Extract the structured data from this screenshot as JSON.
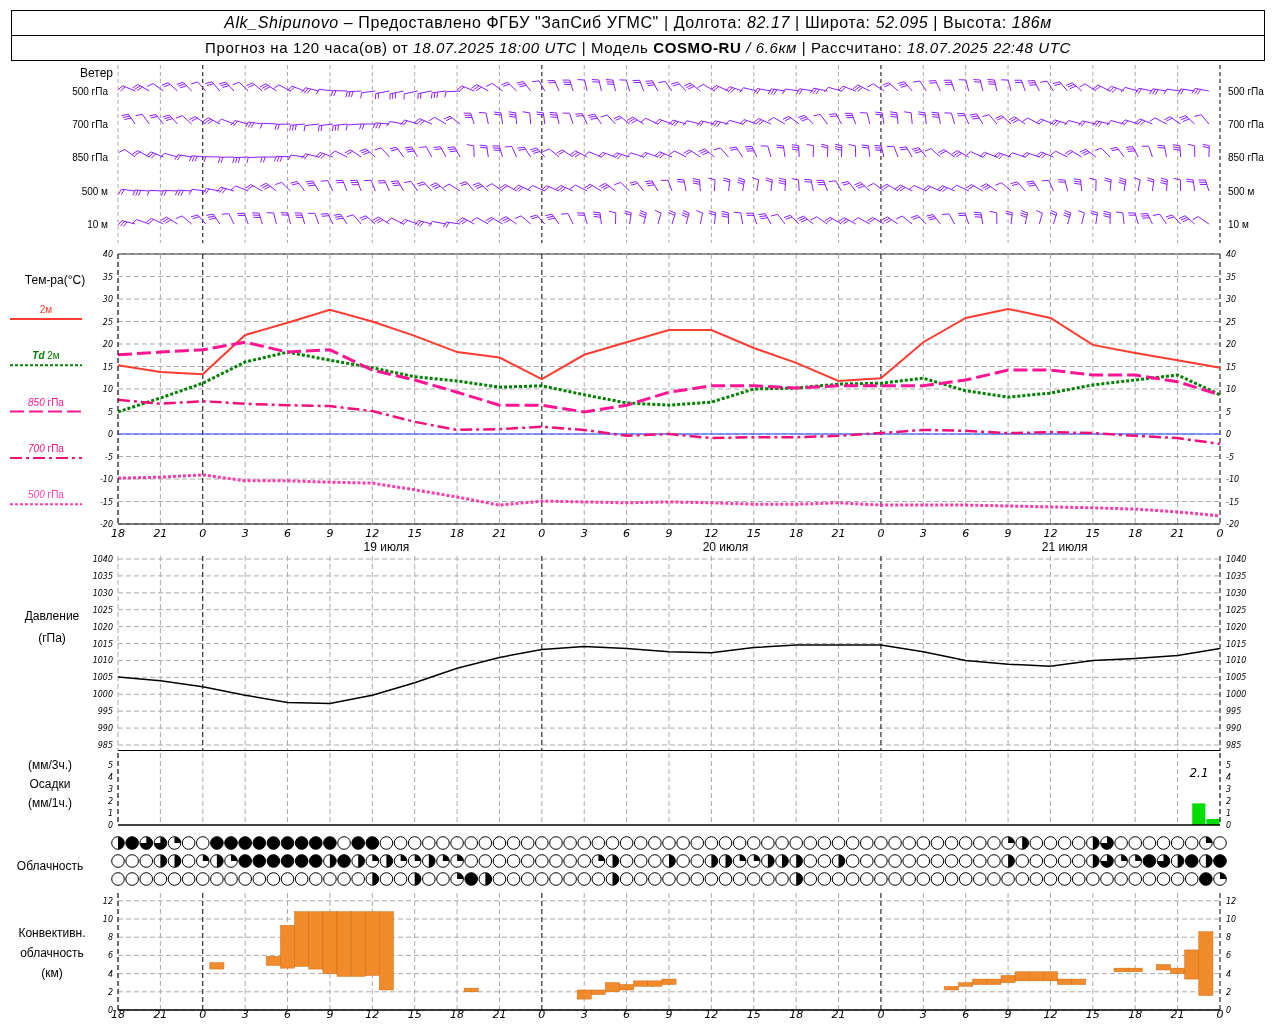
{
  "header": {
    "line_1": "*Alk_Shipunovo* – Предоставлено ФГБУ \"ЗапСиб УГМС\" | Долгота: *82.17* | Широта: *52.095* | Высота: *186м*",
    "line_2": "Прогноз на 120 часа(ов) от *18.07.2025 18:00 UTC*  | Модель **COSMO-RU** */ 6.6км* | Рассчитано: *18.07.2025 22:48 UTC*"
  },
  "wind": {
    "title": "Ветер",
    "levels": [
      "500 гПа",
      "700 гПа",
      "850 гПа",
      "500 м",
      "10 м"
    ],
    "levels_right": [
      "500 гПа",
      "700 гПа",
      "850 гПа",
      "500 м",
      "10 м"
    ]
  },
  "temperature": {
    "title": "Тем-ра(°C)",
    "dates": [
      "19 июля",
      "20 июля",
      "21 июля"
    ],
    "left_labels": [
      "40",
      "35",
      "30",
      "25",
      "20",
      "15",
      "10",
      "5",
      "0",
      "-5",
      "-10",
      "-15",
      "-20"
    ],
    "right_labels": [
      "40",
      "35",
      "30",
      "25",
      "20",
      "15",
      "10",
      "5",
      "0",
      "-5",
      "-10",
      "-15",
      "-20"
    ],
    "chart_data": {
      "type": "line",
      "categories": [
        "18",
        "21",
        "0",
        "3",
        "6",
        "9",
        "12",
        "15",
        "18",
        "21",
        "0",
        "3",
        "6",
        "9",
        "12",
        "15",
        "18",
        "21",
        "0",
        "3",
        "6",
        "9",
        "12",
        "15",
        "18",
        "21",
        "0"
      ],
      "series": [
        {
          "name": "2м",
          "line_style": "solid",
          "color": "#ff3b30",
          "values": [
            15.3,
            13.8,
            13.3,
            22,
            24.7,
            27.6,
            25,
            21.8,
            18.2,
            17,
            12.2,
            17.6,
            20.4,
            23.1,
            23.1,
            19.1,
            15.8,
            11.8,
            12.4,
            20.4,
            25.8,
            27.8,
            25.8,
            19.8,
            18,
            16.4,
            14.7
          ]
        },
        {
          "name": "**Td**  2м",
          "line_style": "dotted",
          "color": "#008000",
          "values": [
            4.9,
            8,
            11.3,
            16,
            18.2,
            16.4,
            14.7,
            12.7,
            11.8,
            10.4,
            10.7,
            8.7,
            6.9,
            6.4,
            7.1,
            10,
            10.2,
            11.1,
            11.3,
            12.4,
            9.6,
            8.2,
            9.1,
            10.9,
            12,
            13.1,
            8.7
          ]
        },
        {
          "name": "*850* гПа",
          "line_style": "dashed",
          "color": "#ff1493",
          "values": [
            17.6,
            18.2,
            18.7,
            20.4,
            18.2,
            18.7,
            14.2,
            12,
            9.3,
            6.4,
            6.4,
            4.9,
            6.4,
            9.3,
            10.7,
            10.7,
            10.2,
            10.7,
            10.7,
            10.7,
            12,
            14.2,
            14.2,
            13.1,
            13.1,
            11.6,
            8.7
          ]
        },
        {
          "name": "*700* гПа",
          "line_style": "dashdot",
          "color": "#f0107a",
          "values": [
            7.6,
            6.7,
            7.3,
            6.7,
            6.4,
            6.2,
            5.1,
            2.7,
            0.9,
            1.1,
            1.6,
            0.9,
            -0.4,
            0,
            -0.9,
            -0.7,
            -0.7,
            -0.4,
            0.2,
            0.9,
            0.7,
            0.2,
            0.4,
            0.2,
            -0.4,
            -0.9,
            -2.2
          ]
        },
        {
          "name": "*500* гПа",
          "line_style": "dotted",
          "color": "#ff3ca8",
          "values": [
            -9.8,
            -9.6,
            -9.1,
            -10.4,
            -10.4,
            -10.7,
            -10.9,
            -12.4,
            -14,
            -15.8,
            -14.9,
            -15.1,
            -15.3,
            -15.1,
            -15.3,
            -15.6,
            -15.6,
            -15.3,
            -15.8,
            -15.8,
            -15.8,
            -16,
            -16.2,
            -16.4,
            -16.7,
            -17.3,
            -18.2
          ]
        }
      ],
      "ylim": [
        -20,
        40
      ],
      "yticks": [
        -20,
        -15,
        -10,
        -5,
        0,
        5,
        10,
        15,
        20,
        25,
        30,
        35,
        40
      ],
      "grid": true,
      "ref_lines": [
        {
          "axis": "y",
          "value": 0,
          "color": "#2040ff"
        }
      ]
    }
  },
  "pressure": {
    "title": "Давление",
    "unit": "(гПа)",
    "left_labels": [
      "1040",
      "1035",
      "1030",
      "1025",
      "1020",
      "1015",
      "1010",
      "1005",
      "1000",
      "995",
      "990",
      "985"
    ],
    "right_labels": [
      "1040",
      "1035",
      "1030",
      "1025",
      "1020",
      "1015",
      "1010",
      "1005",
      "1000",
      "995",
      "990",
      "985"
    ],
    "chart_data": {
      "type": "line",
      "series": [
        {
          "color": "#000000",
          "values": [
            1005.1,
            1004,
            1002.2,
            999.7,
            997.6,
            997.3,
            999.7,
            1003.4,
            1007.7,
            1010.9,
            1013.2,
            1014.1,
            1013.5,
            1012.6,
            1012.3,
            1013.8,
            1014.6,
            1014.6,
            1014.6,
            1012.6,
            1010,
            1008.9,
            1008.3,
            1010,
            1010.6,
            1011.5,
            1013.5
          ]
        }
      ],
      "ylim": [
        985,
        1040
      ],
      "yticks": [
        985,
        990,
        995,
        1000,
        1005,
        1010,
        1015,
        1020,
        1025,
        1030,
        1035,
        1040
      ],
      "grid": true
    }
  },
  "precipitation": {
    "labels": [
      "(мм/3ч.)",
      "Осадки",
      "(мм/1ч.)"
    ],
    "left_labels": [
      "5",
      "4",
      "3",
      "2",
      "1",
      "0"
    ],
    "right_labels": [
      "5",
      "4",
      "3",
      "2",
      "1",
      "0"
    ],
    "chart_data": {
      "type": "bar",
      "series": [
        {
          "color": "#00dd00",
          "values": [
            null,
            null,
            null,
            null,
            null,
            null,
            null,
            null,
            null,
            null,
            null,
            null,
            null,
            null,
            null,
            null,
            null,
            null,
            null,
            null,
            null,
            null,
            null,
            null,
            null,
            1.8
          ]
        },
        {
          "color": "#00dd00",
          "values": [
            null,
            null,
            null,
            null,
            null,
            null,
            null,
            null,
            null,
            null,
            null,
            null,
            null,
            null,
            null,
            null,
            null,
            null,
            null,
            null,
            null,
            null,
            null,
            null,
            null,
            0.5
          ]
        }
      ],
      "ylim": [
        0,
        6
      ],
      "yticks": [
        0,
        1,
        2,
        3,
        4,
        5
      ],
      "annotations": [
        "2.1"
      ]
    }
  },
  "clouds": {
    "title": "Облачность",
    "rows": [
      {
        "cells": [
          {
            "kind": "half"
          },
          {
            "kind": "overcast"
          },
          {
            "kind": "most"
          },
          {
            "kind": "most"
          },
          {
            "kind": "quarter"
          },
          {
            "kind": "clear"
          },
          {
            "kind": "clear"
          },
          {
            "kind": "overcast"
          },
          {
            "kind": "overcast"
          },
          {
            "kind": "overcast"
          },
          {
            "kind": "overcast"
          },
          {
            "kind": "overcast"
          },
          {
            "kind": "overcast"
          },
          {
            "kind": "overcast"
          },
          {
            "kind": "overcast"
          },
          {
            "kind": "overcast"
          },
          {
            "kind": "clear"
          },
          {
            "kind": "overcast"
          },
          {
            "kind": "overcast"
          },
          {
            "kind": "clear"
          },
          {
            "kind": "clear"
          },
          {
            "kind": "clear"
          },
          {
            "kind": "clear"
          },
          {
            "kind": "clear"
          },
          {
            "kind": "clear"
          },
          {
            "kind": "clear"
          },
          {
            "kind": "clear"
          },
          {
            "kind": "clear"
          },
          {
            "kind": "clear"
          },
          {
            "kind": "clear"
          },
          {
            "kind": "clear"
          },
          {
            "kind": "clear"
          },
          {
            "kind": "clear"
          },
          {
            "kind": "clear"
          },
          {
            "kind": "clear"
          },
          {
            "kind": "clear"
          },
          {
            "kind": "clear"
          },
          {
            "kind": "clear"
          },
          {
            "kind": "clear"
          },
          {
            "kind": "clear"
          },
          {
            "kind": "clear"
          },
          {
            "kind": "clear"
          },
          {
            "kind": "clear"
          },
          {
            "kind": "clear"
          },
          {
            "kind": "clear"
          },
          {
            "kind": "clear"
          },
          {
            "kind": "clear"
          },
          {
            "kind": "clear"
          },
          {
            "kind": "clear"
          },
          {
            "kind": "clear"
          },
          {
            "kind": "clear"
          },
          {
            "kind": "clear"
          },
          {
            "kind": "clear"
          },
          {
            "kind": "clear"
          },
          {
            "kind": "clear"
          },
          {
            "kind": "clear"
          },
          {
            "kind": "clear"
          },
          {
            "kind": "clear"
          },
          {
            "kind": "clear"
          },
          {
            "kind": "clear"
          },
          {
            "kind": "clear"
          },
          {
            "kind": "clear"
          },
          {
            "kind": "clear"
          },
          {
            "kind": "quarter"
          },
          {
            "kind": "half"
          },
          {
            "kind": "clear"
          },
          {
            "kind": "clear"
          },
          {
            "kind": "clear"
          },
          {
            "kind": "clear"
          },
          {
            "kind": "half"
          },
          {
            "kind": "most"
          },
          {
            "kind": "clear"
          },
          {
            "kind": "clear"
          },
          {
            "kind": "clear"
          },
          {
            "kind": "clear"
          },
          {
            "kind": "clear"
          },
          {
            "kind": "clear"
          },
          {
            "kind": "quarter"
          },
          {
            "kind": "clear"
          }
        ]
      },
      {
        "cells": [
          {
            "kind": "clear"
          },
          {
            "kind": "clear"
          },
          {
            "kind": "clear"
          },
          {
            "kind": "half"
          },
          {
            "kind": "half"
          },
          {
            "kind": "clear"
          },
          {
            "kind": "quarter"
          },
          {
            "kind": "half"
          },
          {
            "kind": "quarter"
          },
          {
            "kind": "overcast"
          },
          {
            "kind": "overcast"
          },
          {
            "kind": "overcast"
          },
          {
            "kind": "overcast"
          },
          {
            "kind": "overcast"
          },
          {
            "kind": "overcast"
          },
          {
            "kind": "half"
          },
          {
            "kind": "overcast"
          },
          {
            "kind": "half"
          },
          {
            "kind": "quarter"
          },
          {
            "kind": "half"
          },
          {
            "kind": "quarter"
          },
          {
            "kind": "quarter"
          },
          {
            "kind": "half"
          },
          {
            "kind": "quarter"
          },
          {
            "kind": "quarter"
          },
          {
            "kind": "clear"
          },
          {
            "kind": "clear"
          },
          {
            "kind": "clear"
          },
          {
            "kind": "clear"
          },
          {
            "kind": "clear"
          },
          {
            "kind": "clear"
          },
          {
            "kind": "clear"
          },
          {
            "kind": "clear"
          },
          {
            "kind": "clear"
          },
          {
            "kind": "quarter"
          },
          {
            "kind": "half"
          },
          {
            "kind": "clear"
          },
          {
            "kind": "clear"
          },
          {
            "kind": "clear"
          },
          {
            "kind": "half"
          },
          {
            "kind": "clear"
          },
          {
            "kind": "clear"
          },
          {
            "kind": "half"
          },
          {
            "kind": "half"
          },
          {
            "kind": "quarter"
          },
          {
            "kind": "quarter"
          },
          {
            "kind": "half"
          },
          {
            "kind": "half"
          },
          {
            "kind": "half"
          },
          {
            "kind": "clear"
          },
          {
            "kind": "clear"
          },
          {
            "kind": "half"
          },
          {
            "kind": "clear"
          },
          {
            "kind": "clear"
          },
          {
            "kind": "clear"
          },
          {
            "kind": "clear"
          },
          {
            "kind": "clear"
          },
          {
            "kind": "clear"
          },
          {
            "kind": "clear"
          },
          {
            "kind": "clear"
          },
          {
            "kind": "clear"
          },
          {
            "kind": "clear"
          },
          {
            "kind": "clear"
          },
          {
            "kind": "half"
          },
          {
            "kind": "clear"
          },
          {
            "kind": "clear"
          },
          {
            "kind": "clear"
          },
          {
            "kind": "clear"
          },
          {
            "kind": "clear"
          },
          {
            "kind": "half"
          },
          {
            "kind": "most"
          },
          {
            "kind": "quarter"
          },
          {
            "kind": "quarter"
          },
          {
            "kind": "overcast"
          },
          {
            "kind": "most"
          },
          {
            "kind": "half"
          },
          {
            "kind": "overcast"
          },
          {
            "kind": "half"
          },
          {
            "kind": "overcast"
          }
        ]
      },
      {
        "cells": [
          {
            "kind": "clear"
          },
          {
            "kind": "clear"
          },
          {
            "kind": "clear"
          },
          {
            "kind": "clear"
          },
          {
            "kind": "clear"
          },
          {
            "kind": "clear"
          },
          {
            "kind": "clear"
          },
          {
            "kind": "clear"
          },
          {
            "kind": "clear"
          },
          {
            "kind": "clear"
          },
          {
            "kind": "clear"
          },
          {
            "kind": "clear"
          },
          {
            "kind": "clear"
          },
          {
            "kind": "clear"
          },
          {
            "kind": "clear"
          },
          {
            "kind": "clear"
          },
          {
            "kind": "clear"
          },
          {
            "kind": "clear"
          },
          {
            "kind": "half"
          },
          {
            "kind": "clear"
          },
          {
            "kind": "clear"
          },
          {
            "kind": "half"
          },
          {
            "kind": "clear"
          },
          {
            "kind": "clear"
          },
          {
            "kind": "quarter"
          },
          {
            "kind": "overcast"
          },
          {
            "kind": "half"
          },
          {
            "kind": "clear"
          },
          {
            "kind": "clear"
          },
          {
            "kind": "clear"
          },
          {
            "kind": "clear"
          },
          {
            "kind": "clear"
          },
          {
            "kind": "clear"
          },
          {
            "kind": "clear"
          },
          {
            "kind": "clear"
          },
          {
            "kind": "half"
          },
          {
            "kind": "clear"
          },
          {
            "kind": "clear"
          },
          {
            "kind": "clear"
          },
          {
            "kind": "clear"
          },
          {
            "kind": "clear"
          },
          {
            "kind": "clear"
          },
          {
            "kind": "clear"
          },
          {
            "kind": "clear"
          },
          {
            "kind": "clear"
          },
          {
            "kind": "clear"
          },
          {
            "kind": "clear"
          },
          {
            "kind": "clear"
          },
          {
            "kind": "half"
          },
          {
            "kind": "clear"
          },
          {
            "kind": "clear"
          },
          {
            "kind": "clear"
          },
          {
            "kind": "clear"
          },
          {
            "kind": "clear"
          },
          {
            "kind": "clear"
          },
          {
            "kind": "clear"
          },
          {
            "kind": "clear"
          },
          {
            "kind": "clear"
          },
          {
            "kind": "clear"
          },
          {
            "kind": "clear"
          },
          {
            "kind": "clear"
          },
          {
            "kind": "clear"
          },
          {
            "kind": "clear"
          },
          {
            "kind": "clear"
          },
          {
            "kind": "clear"
          },
          {
            "kind": "clear"
          },
          {
            "kind": "clear"
          },
          {
            "kind": "clear"
          },
          {
            "kind": "clear"
          },
          {
            "kind": "clear"
          },
          {
            "kind": "clear"
          },
          {
            "kind": "clear"
          },
          {
            "kind": "clear"
          },
          {
            "kind": "clear"
          },
          {
            "kind": "clear"
          },
          {
            "kind": "clear"
          },
          {
            "kind": "clear"
          },
          {
            "kind": "overcast"
          },
          {
            "kind": "quarter"
          }
        ]
      }
    ]
  },
  "convective": {
    "labels": [
      "Конвективн.",
      "облачность",
      "(км)"
    ],
    "left_labels": [
      "12",
      "10",
      "8",
      "6",
      "4",
      "2",
      "0"
    ],
    "right_labels": [
      "12",
      "10",
      "8",
      "6",
      "4",
      "2",
      "0"
    ],
    "chart_data": {
      "type": "bar",
      "categories": [
        "18",
        null,
        null,
        "21",
        null,
        null,
        "0",
        null,
        null,
        "3",
        null,
        null,
        "6",
        null,
        null,
        "9",
        null,
        null,
        "12",
        null,
        null,
        "15",
        null,
        null,
        "18",
        null,
        null,
        "21",
        null,
        null,
        "0",
        null,
        null,
        "3",
        null,
        null,
        "6",
        null,
        null,
        "9",
        null,
        null,
        "12",
        null,
        null,
        "15",
        null,
        null,
        "18",
        null,
        null,
        "21",
        null,
        null,
        "0",
        null,
        null,
        "3",
        null,
        null,
        "6",
        null,
        null,
        "9",
        null,
        null,
        "12",
        null,
        null,
        "15",
        null,
        null,
        "18",
        null,
        null,
        "21",
        null,
        null,
        "0"
      ],
      "series": [
        {
          "color": "#f08a2a",
          "values": [
            null,
            null,
            null,
            null,
            null,
            null,
            null,
            0.7,
            null,
            null,
            null,
            1.0,
            4.7,
            6.0,
            6.3,
            6.8,
            7.1,
            7.1,
            7.0,
            8.6,
            null,
            null,
            null,
            null,
            null,
            0.4,
            null,
            null,
            null,
            null,
            null,
            null,
            null,
            1.0,
            0.5,
            1.0,
            0.6,
            0.6,
            0.6,
            0.6,
            null,
            null,
            null,
            null,
            null,
            null,
            null,
            null,
            null,
            null,
            null,
            null,
            null,
            null,
            null,
            null,
            null,
            null,
            null,
            0.4,
            0.4,
            0.6,
            0.6,
            0.8,
            1.0,
            1.0,
            1.0,
            0.6,
            0.6,
            null,
            null,
            0.4,
            0.4,
            null,
            0.6,
            0.6,
            3.2,
            7.0,
            null
          ],
          "base": [
            null,
            null,
            null,
            null,
            null,
            null,
            null,
            4.5,
            null,
            null,
            null,
            4.9,
            4.6,
            4.8,
            4.5,
            4.0,
            3.7,
            3.7,
            3.8,
            2.2,
            null,
            null,
            null,
            null,
            null,
            2.0,
            null,
            null,
            null,
            null,
            null,
            null,
            null,
            1.2,
            1.7,
            2.0,
            2.2,
            2.6,
            2.6,
            2.8,
            null,
            null,
            null,
            null,
            null,
            null,
            null,
            null,
            null,
            null,
            null,
            null,
            null,
            null,
            null,
            null,
            null,
            null,
            null,
            2.2,
            2.6,
            2.8,
            2.8,
            3.0,
            3.2,
            3.2,
            3.2,
            2.8,
            2.8,
            null,
            null,
            4.2,
            4.2,
            null,
            4.4,
            4.0,
            3.4,
            1.6,
            null
          ]
        }
      ],
      "ylim": [
        0,
        12
      ],
      "yticks": [
        0,
        2,
        4,
        6,
        8,
        10,
        12
      ],
      "grid": true
    }
  }
}
